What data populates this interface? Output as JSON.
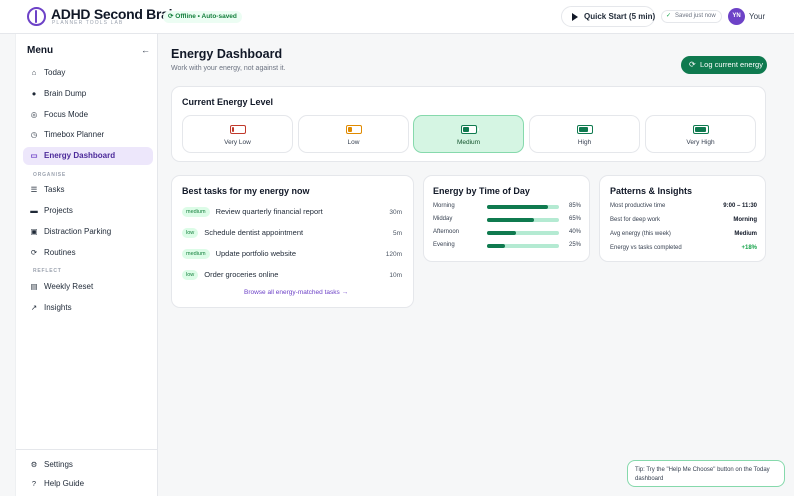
{
  "header": {
    "app_title": "ADHD Second Brain",
    "app_subtitle": "PLANNER TOOLS LAB",
    "offline_status": "Offline • Auto-saved",
    "quick_start_label": "Quick Start (5 min)",
    "saved_status": "Saved just now",
    "avatar_initials": "YN",
    "user_label": "Your"
  },
  "sidebar": {
    "title": "Menu",
    "items": [
      {
        "label": "Today",
        "icon": "home-icon"
      },
      {
        "label": "Brain Dump",
        "icon": "lightbulb-icon"
      },
      {
        "label": "Focus Mode",
        "icon": "target-icon"
      },
      {
        "label": "Timebox Planner",
        "icon": "clock-icon"
      },
      {
        "label": "Energy Dashboard",
        "icon": "battery-icon",
        "active": true
      }
    ],
    "section_organise": "ORGANISE",
    "organise_items": [
      {
        "label": "Tasks",
        "icon": "list-icon"
      },
      {
        "label": "Projects",
        "icon": "folder-icon"
      },
      {
        "label": "Distraction Parking",
        "icon": "note-icon"
      },
      {
        "label": "Routines",
        "icon": "repeat-icon"
      }
    ],
    "section_reflect": "REFLECT",
    "reflect_items": [
      {
        "label": "Weekly Reset",
        "icon": "calendar-icon"
      },
      {
        "label": "Insights",
        "icon": "chart-icon"
      }
    ],
    "bottom_items": [
      {
        "label": "Settings",
        "icon": "gear-icon"
      },
      {
        "label": "Help Guide",
        "icon": "help-icon"
      }
    ]
  },
  "main": {
    "title": "Energy Dashboard",
    "subtitle": "Work with your energy, not against it.",
    "log_button": "Log current energy",
    "energy_card": {
      "title": "Current Energy Level",
      "levels": [
        {
          "label": "Very Low",
          "color": "#c0392b",
          "fill": 0.15
        },
        {
          "label": "Low",
          "color": "#e08a00",
          "fill": 0.35
        },
        {
          "label": "Medium",
          "color": "#0f7a4f",
          "fill": 0.55,
          "selected": true
        },
        {
          "label": "High",
          "color": "#0f7a4f",
          "fill": 0.8
        },
        {
          "label": "Very High",
          "color": "#0f7a4f",
          "fill": 1.0
        }
      ]
    },
    "tasks_card": {
      "title": "Best tasks for my energy now",
      "tasks": [
        {
          "tag": "medium",
          "name": "Review quarterly financial report",
          "duration": "30m"
        },
        {
          "tag": "low",
          "name": "Schedule dentist appointment",
          "duration": "5m"
        },
        {
          "tag": "medium",
          "name": "Update portfolio website",
          "duration": "120m"
        },
        {
          "tag": "low",
          "name": "Order groceries online",
          "duration": "10m"
        }
      ],
      "browse_link": "Browse all energy-matched tasks"
    },
    "time_card": {
      "title": "Energy by Time of Day",
      "rows": [
        {
          "label": "Morning",
          "value": 85,
          "pct": "85%"
        },
        {
          "label": "Midday",
          "value": 65,
          "pct": "65%"
        },
        {
          "label": "Afternoon",
          "value": 40,
          "pct": "40%"
        },
        {
          "label": "Evening",
          "value": 25,
          "pct": "25%"
        }
      ]
    },
    "patterns_card": {
      "title": "Patterns & Insights",
      "rows": [
        {
          "label": "Most productive time",
          "value": "9:00 – 11:30"
        },
        {
          "label": "Best for deep work",
          "value": "Morning"
        },
        {
          "label": "Avg energy (this week)",
          "value": "Medium"
        },
        {
          "label": "Energy vs tasks completed",
          "value": "+18%"
        }
      ]
    }
  },
  "tip": "Tip: Try the \"Help Me Choose\" button on the Today dashboard"
}
